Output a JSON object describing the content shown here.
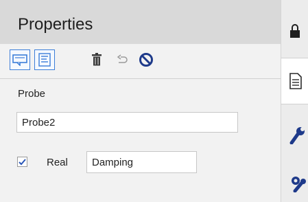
{
  "panel": {
    "title": "Properties"
  },
  "toolbar": {
    "buttons": [
      {
        "icon": "comment-box-icon",
        "active": true
      },
      {
        "icon": "text-lines-icon",
        "active": true
      },
      {
        "icon": "trash-icon",
        "active": false
      },
      {
        "icon": "undo-return-icon",
        "active": false,
        "disabled": true
      },
      {
        "icon": "ban-icon",
        "active": false
      }
    ]
  },
  "probe": {
    "label": "Probe",
    "name_value": "Probe2"
  },
  "real": {
    "checked": true,
    "label": "Real",
    "value": "Damping"
  },
  "side_tabs": [
    {
      "icon": "lock-icon"
    },
    {
      "icon": "document-icon",
      "active": true
    },
    {
      "icon": "wrench-icon"
    },
    {
      "icon": "gear-wrench-icon"
    }
  ],
  "colors": {
    "accent_blue": "#3b7dd8",
    "icon_dark": "#3a3a3a",
    "header_bg": "#d9d9d9"
  }
}
